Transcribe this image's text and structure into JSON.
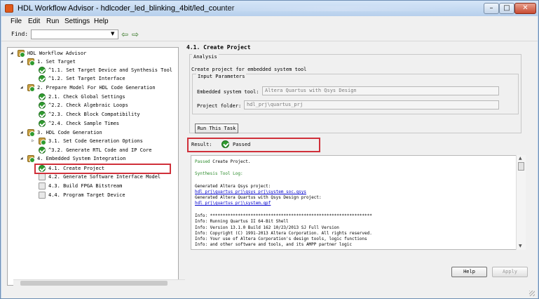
{
  "window": {
    "title": "HDL Workflow Advisor - hdlcoder_led_blinking_4bit/led_counter",
    "minimize": "–",
    "maximize": "□",
    "close": "✕"
  },
  "menu": [
    "File",
    "Edit",
    "Run",
    "Settings",
    "Help"
  ],
  "find": {
    "label": "Find:",
    "value": ""
  },
  "tree": [
    {
      "label": "HDL Workflow Advisor",
      "icon": "folder"
    },
    {
      "label": "1. Set Target",
      "icon": "folder"
    },
    {
      "label": "^1.1. Set Target Device and Synthesis Tool",
      "icon": "ok"
    },
    {
      "label": "^1.2. Set Target Interface",
      "icon": "ok"
    },
    {
      "label": "2. Prepare Model For HDL Code Generation",
      "icon": "folder"
    },
    {
      "label": "2.1. Check Global Settings",
      "icon": "ok"
    },
    {
      "label": "^2.2. Check Algebraic Loops",
      "icon": "ok"
    },
    {
      "label": "^2.3. Check Block Compatibility",
      "icon": "ok"
    },
    {
      "label": "^2.4. Check Sample Times",
      "icon": "ok"
    },
    {
      "label": "3. HDL Code Generation",
      "icon": "folder"
    },
    {
      "label": "3.1. Set Code Generation Options",
      "icon": "folder"
    },
    {
      "label": "^3.2. Generate RTL Code and IP Core",
      "icon": "ok"
    },
    {
      "label": "4. Embedded System Integration",
      "icon": "folder"
    },
    {
      "label": "4.1. Create Project",
      "icon": "ok"
    },
    {
      "label": "4.2. Generate Software Interface Model",
      "icon": "task"
    },
    {
      "label": "4.3. Build FPGA Bitstream",
      "icon": "task"
    },
    {
      "label": "4.4. Program Target Device",
      "icon": "task"
    }
  ],
  "task": {
    "heading": "4.1. Create Project",
    "analysis_label": "Analysis",
    "description": "Create project for embedded system tool",
    "params_label": "Input Parameters",
    "embedded_tool_label": "Embedded system tool:",
    "embedded_tool_value": "Altera Quartus with Qsys Design",
    "project_folder_label": "Project folder:",
    "project_folder_value": "hdl_prj\\quartus_prj",
    "run_button": "Run This Task",
    "result_label": "Result:",
    "result_value": "Passed"
  },
  "report": {
    "passed_word": "Passed",
    "passed_rest": " Create Project.",
    "synth_title": "Synthesis Tool Log:",
    "lines": [
      {
        "text": "Generated Altera Qsys project:",
        "link": false
      },
      {
        "text": "hdl_prj\\quartus_prj\\qsys_prj\\system_soc.qsys",
        "link": true
      },
      {
        "text": "Generated Altera Quartus with Qsys Design project:",
        "link": false
      },
      {
        "text": "hdl_prj\\quartus_prj\\system.qpf",
        "link": true
      },
      {
        "text": "",
        "link": false
      },
      {
        "text": "Info: ****************************************************************",
        "link": false
      },
      {
        "text": "Info: Running Quartus II 64-Bit Shell",
        "link": false
      },
      {
        "text": "    Info: Version 13.1.0 Build 162 10/23/2013 SJ Full Version",
        "link": false
      },
      {
        "text": "    Info: Copyright (C) 1991-2013 Altera Corporation. All rights reserved.",
        "link": false
      },
      {
        "text": "    Info: Your use of Altera Corporation's design tools, logic functions",
        "link": false
      },
      {
        "text": "    Info: and other software and tools, and its AMPP partner logic",
        "link": false
      }
    ]
  },
  "buttons": {
    "help": "Help",
    "apply": "Apply"
  }
}
